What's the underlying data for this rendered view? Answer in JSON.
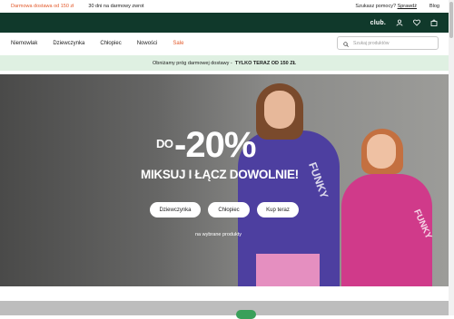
{
  "topbar": {
    "shipping": "Darmowa dostawa od 150 zł",
    "returns": "30 dni na darmowy zwrot",
    "help_question": "Szukasz pomocy?",
    "help_link": "Sprawdź",
    "blog": "Blog"
  },
  "header": {
    "club": "club."
  },
  "nav": {
    "items": [
      "Niemowlak",
      "Dziewczynka",
      "Chłopiec",
      "Nowości"
    ],
    "sale": "Sale"
  },
  "search": {
    "placeholder": "Szukaj produktów"
  },
  "promo": {
    "text": "Obniżamy próg darmowej dostawy -",
    "cta": "TYLKO TERAZ OD 150 ZŁ"
  },
  "hero": {
    "prefix": "DO",
    "discount": "-20%",
    "headline": "MIKSUJ I ŁĄCZ DOWOLNIE!",
    "buttons": [
      "Dziewczynka",
      "Chłopiec",
      "Kup teraz"
    ],
    "note": "na wybrane produkty",
    "image_text": [
      "FUNKY",
      "FUNKY"
    ]
  },
  "colors": {
    "accent": "#e35a2b",
    "header_bg": "#10392b",
    "promo_bg": "#dff0e2"
  }
}
